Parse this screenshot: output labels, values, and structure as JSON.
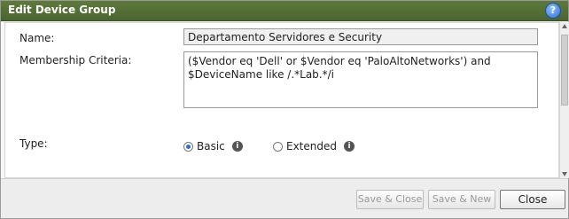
{
  "dialog": {
    "title": "Edit Device Group",
    "help_icon": "help-question-icon",
    "help_glyph": "?"
  },
  "form": {
    "name_label": "Name:",
    "name_value": "Departamento Servidores e Security",
    "criteria_label": "Membership Criteria:",
    "criteria_value": "($Vendor eq 'Dell' or $Vendor eq 'PaloAltoNetworks') and $DeviceName like /.*Lab.*/i",
    "type_label": "Type:",
    "type_options": [
      {
        "label": "Basic",
        "selected": true
      },
      {
        "label": "Extended",
        "selected": false
      }
    ],
    "info_glyph": "i"
  },
  "footer": {
    "save_close": "Save & Close",
    "save_new": "Save & New",
    "close": "Close"
  },
  "colors": {
    "titlebar": "#4a6530",
    "accent": "#2f6fd0"
  }
}
